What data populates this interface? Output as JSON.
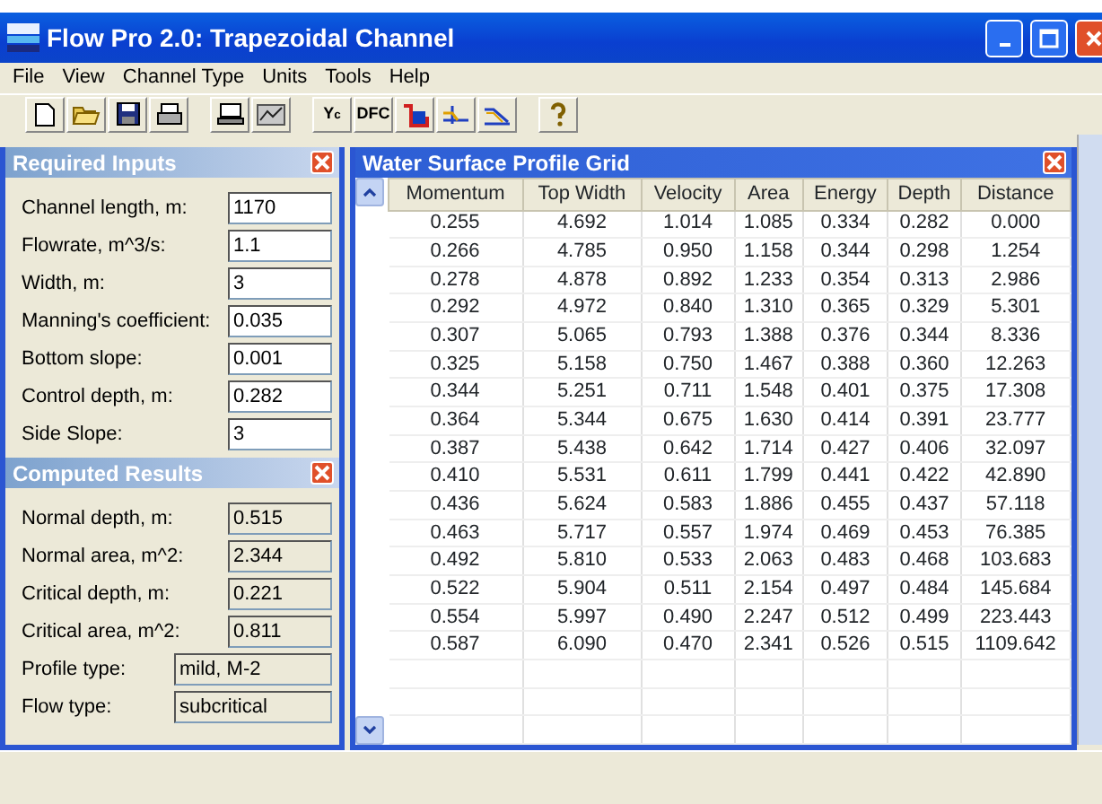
{
  "window": {
    "title": "Flow Pro 2.0: Trapezoidal Channel"
  },
  "menu": [
    "File",
    "View",
    "Channel Type",
    "Units",
    "Tools",
    "Help"
  ],
  "toolbar": [
    {
      "kind": "icon"
    },
    {
      "kind": "icon"
    },
    {
      "kind": "icon"
    },
    {
      "kind": "icon"
    },
    {
      "kind": "gap"
    },
    {
      "kind": "icon"
    },
    {
      "kind": "icon"
    },
    {
      "kind": "gap"
    },
    {
      "kind": "text",
      "label": "Y$_{c}$"
    },
    {
      "kind": "text",
      "label": "DFC"
    },
    {
      "kind": "icon"
    },
    {
      "kind": "icon"
    },
    {
      "kind": "icon"
    },
    {
      "kind": "gap"
    },
    {
      "kind": "icon"
    }
  ],
  "required_inputs": {
    "title": "Required Inputs",
    "fields": [
      {
        "label": "Channel length, m:",
        "value": "1170"
      },
      {
        "label": "Flowrate, m^3/s:",
        "value": "1.1"
      },
      {
        "label": "Width, m:",
        "value": "3"
      },
      {
        "label": "Manning's coefficient:",
        "value": "0.035"
      },
      {
        "label": "Bottom slope:",
        "value": "0.001"
      },
      {
        "label": "Control depth, m:",
        "value": "0.282"
      },
      {
        "label": "Side Slope:",
        "value": "3"
      }
    ]
  },
  "computed_results": {
    "title": "Computed Results",
    "fields": [
      {
        "label": "Normal depth, m:",
        "value": "0.515"
      },
      {
        "label": "Normal area, m^2:",
        "value": "2.344"
      },
      {
        "label": "Critical depth, m:",
        "value": "0.221"
      },
      {
        "label": "Critical area, m^2:",
        "value": "0.811"
      },
      {
        "label": "Profile type:",
        "value": "mild, M-2"
      },
      {
        "label": "Flow type:",
        "value": "subcritical"
      }
    ]
  },
  "grid": {
    "title": "Water Surface Profile Grid",
    "columns": [
      "Momentum",
      "Top Width",
      "Velocity",
      "Area",
      "Energy",
      "Depth",
      "Distance"
    ],
    "rows": [
      [
        "0.255",
        "4.692",
        "1.014",
        "1.085",
        "0.334",
        "0.282",
        "0.000"
      ],
      [
        "0.266",
        "4.785",
        "0.950",
        "1.158",
        "0.344",
        "0.298",
        "1.254"
      ],
      [
        "0.278",
        "4.878",
        "0.892",
        "1.233",
        "0.354",
        "0.313",
        "2.986"
      ],
      [
        "0.292",
        "4.972",
        "0.840",
        "1.310",
        "0.365",
        "0.329",
        "5.301"
      ],
      [
        "0.307",
        "5.065",
        "0.793",
        "1.388",
        "0.376",
        "0.344",
        "8.336"
      ],
      [
        "0.325",
        "5.158",
        "0.750",
        "1.467",
        "0.388",
        "0.360",
        "12.263"
      ],
      [
        "0.344",
        "5.251",
        "0.711",
        "1.548",
        "0.401",
        "0.375",
        "17.308"
      ],
      [
        "0.364",
        "5.344",
        "0.675",
        "1.630",
        "0.414",
        "0.391",
        "23.777"
      ],
      [
        "0.387",
        "5.438",
        "0.642",
        "1.714",
        "0.427",
        "0.406",
        "32.097"
      ],
      [
        "0.410",
        "5.531",
        "0.611",
        "1.799",
        "0.441",
        "0.422",
        "42.890"
      ],
      [
        "0.436",
        "5.624",
        "0.583",
        "1.886",
        "0.455",
        "0.437",
        "57.118"
      ],
      [
        "0.463",
        "5.717",
        "0.557",
        "1.974",
        "0.469",
        "0.453",
        "76.385"
      ],
      [
        "0.492",
        "5.810",
        "0.533",
        "2.063",
        "0.483",
        "0.468",
        "103.683"
      ],
      [
        "0.522",
        "5.904",
        "0.511",
        "2.154",
        "0.497",
        "0.484",
        "145.684"
      ],
      [
        "0.554",
        "5.997",
        "0.490",
        "2.247",
        "0.512",
        "0.499",
        "223.443"
      ],
      [
        "0.587",
        "6.090",
        "0.470",
        "2.341",
        "0.526",
        "0.515",
        "1109.642"
      ]
    ]
  }
}
